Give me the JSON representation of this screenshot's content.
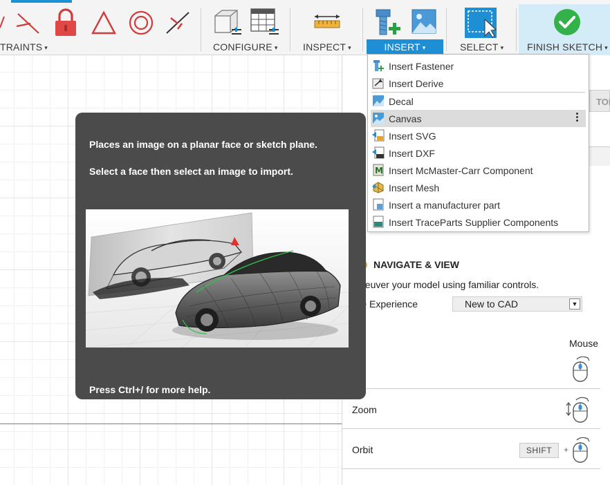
{
  "toolbar": {
    "groups": {
      "constraints": "TRAINTS",
      "configure": "CONFIGURE",
      "inspect": "INSPECT",
      "insert": "INSERT",
      "select": "SELECT",
      "finish_sketch": "FINISH SKETCH"
    },
    "caret": "▾"
  },
  "insert_menu": {
    "items": [
      {
        "label": "Insert Fastener",
        "icon": "fastener-icon"
      },
      {
        "label": "Insert Derive",
        "icon": "derive-icon"
      },
      {
        "label": "Decal",
        "icon": "decal-icon"
      },
      {
        "label": "Canvas",
        "icon": "canvas-icon",
        "highlighted": true
      },
      {
        "label": "Insert SVG",
        "icon": "svg-icon"
      },
      {
        "label": "Insert DXF",
        "icon": "dxf-icon"
      },
      {
        "label": "Insert McMaster-Carr Component",
        "icon": "mcmaster-icon"
      },
      {
        "label": "Insert Mesh",
        "icon": "mesh-icon"
      },
      {
        "label": "Insert a manufacturer part",
        "icon": "manufacturer-part-icon"
      },
      {
        "label": "Insert TraceParts Supplier Components",
        "icon": "traceparts-icon"
      }
    ]
  },
  "tooltip": {
    "line1": "Places an image on a planar face or sketch plane.",
    "line2": "Select a face then select an image to import.",
    "footer": "Press Ctrl+/ for more help."
  },
  "panel": {
    "view_cube_label": "TOI",
    "nav_title": "NAVIGATE & VIEW",
    "nav_desc": "neuver your model using familiar controls.",
    "experience_label": "D Experience",
    "experience_value": "New to CAD",
    "mouse_header": "Mouse",
    "rows": [
      {
        "label": "n"
      },
      {
        "label": "Zoom"
      },
      {
        "label": "Orbit"
      }
    ],
    "shift_key": "SHIFT",
    "plus": "+"
  },
  "colors": {
    "accent": "#1e8fd4",
    "finish_bg": "#d4ecf7",
    "tooltip_bg": "#4b4b4b",
    "axis_red": "#e05050"
  }
}
